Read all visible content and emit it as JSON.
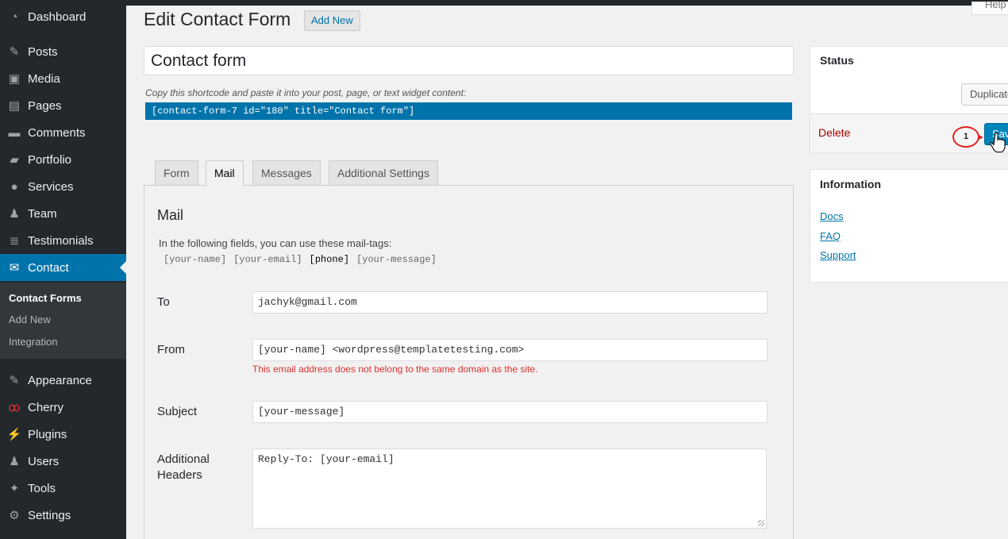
{
  "sidebar": {
    "items": [
      {
        "label": "Dashboard",
        "icon": "dashboard-icon",
        "glyph": "◔"
      },
      {
        "label": "Posts",
        "icon": "pin-icon",
        "glyph": "✎"
      },
      {
        "label": "Media",
        "icon": "media-icon",
        "glyph": "▣"
      },
      {
        "label": "Pages",
        "icon": "pages-icon",
        "glyph": "▤"
      },
      {
        "label": "Comments",
        "icon": "comment-icon",
        "glyph": "▬"
      },
      {
        "label": "Portfolio",
        "icon": "folder-icon",
        "glyph": "▰"
      },
      {
        "label": "Services",
        "icon": "lightbulb-icon",
        "glyph": "●"
      },
      {
        "label": "Team",
        "icon": "team-icon",
        "glyph": "♟"
      },
      {
        "label": "Testimonials",
        "icon": "testimonials-icon",
        "glyph": "≣"
      },
      {
        "label": "Contact",
        "icon": "envelope-icon",
        "glyph": "✉"
      },
      {
        "label": "Appearance",
        "icon": "paintbrush-icon",
        "glyph": "✎"
      },
      {
        "label": "Cherry",
        "icon": "cherry-icon",
        "glyph": "ꝏ"
      },
      {
        "label": "Plugins",
        "icon": "plug-icon",
        "glyph": "⚡"
      },
      {
        "label": "Users",
        "icon": "user-icon",
        "glyph": "♟"
      },
      {
        "label": "Tools",
        "icon": "wrench-icon",
        "glyph": "✦"
      },
      {
        "label": "Settings",
        "icon": "sliders-icon",
        "glyph": "⚙"
      }
    ],
    "submenu": {
      "contact_forms": "Contact Forms",
      "add_new": "Add New",
      "integration": "Integration"
    }
  },
  "topbar": {
    "help": "Help"
  },
  "header": {
    "title": "Edit Contact Form",
    "add_new": "Add New"
  },
  "form": {
    "title_value": "Contact form",
    "shortcode_hint": "Copy this shortcode and paste it into your post, page, or text widget content:",
    "shortcode": "[contact-form-7 id=\"180\" title=\"Contact form\"]"
  },
  "tabs": {
    "form": "Form",
    "mail": "Mail",
    "messages": "Messages",
    "additional": "Additional Settings"
  },
  "mail": {
    "heading": "Mail",
    "note": "In the following fields, you can use these mail-tags:",
    "tags": [
      "[your-name]",
      "[your-email]",
      "[phone]",
      "[your-message]"
    ],
    "to_label": "To",
    "to_value": "jachyk@gmail.com",
    "from_label": "From",
    "from_value": "[your-name] <wordpress@templatetesting.com>",
    "from_error": "This email address does not belong to the same domain as the site.",
    "subject_label": "Subject",
    "subject_value": "[your-message]",
    "headers_label_1": "Additional",
    "headers_label_2": "Headers",
    "headers_value": "Reply-To: [your-email]"
  },
  "status_box": {
    "title": "Status",
    "duplicate": "Duplicate",
    "delete": "Delete",
    "save": "Save",
    "step_marker": "1"
  },
  "info_box": {
    "title": "Information",
    "docs": "Docs",
    "faq": "FAQ",
    "support": "Support"
  },
  "colors": {
    "accent": "#0073aa",
    "sidebar": "#23282d",
    "error": "#dc3232",
    "delete": "#aa0000"
  }
}
